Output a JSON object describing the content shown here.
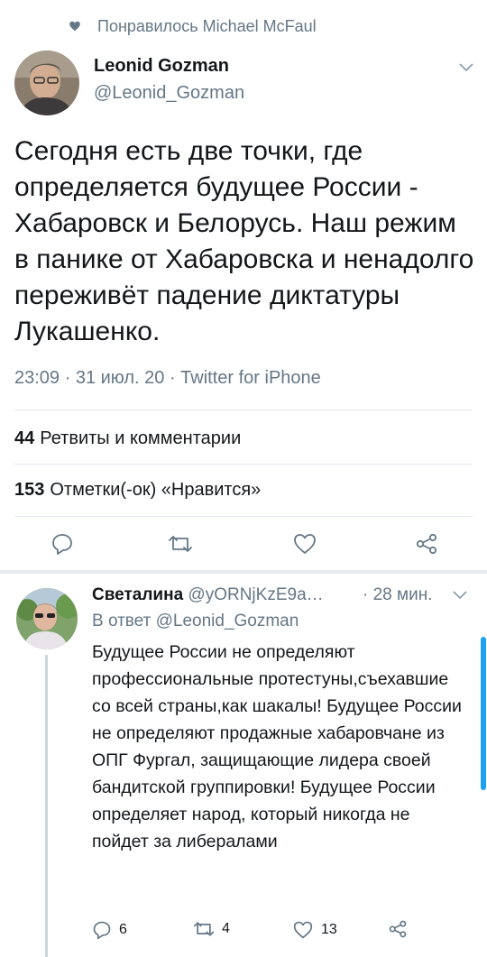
{
  "liked_by": "Понравилось Michael McFaul",
  "tweet": {
    "author_name": "Leonid Gozman",
    "author_handle": "@Leonid_Gozman",
    "text": "Сегодня есть две точки, где определяется будущее России - Хабаровск и Белорусь. Наш режим в панике от Хабаровска и ненадолго переживёт падение диктатуры Лукашенко.",
    "meta": "23:09 · 31 июл. 20 · Twitter for iPhone",
    "retweets_count": "44",
    "retweets_label": "Ретвиты и комментарии",
    "likes_count": "153",
    "likes_label": "Отметки(-ок) «Нравится»"
  },
  "reply": {
    "author_name": "Светалина",
    "author_handle": "@yORNjKzE9a…",
    "time": "· 28 мин.",
    "reply_to": "В ответ @Leonid_Gozman",
    "text": "Будущее России не определяют профессиональные протестуны,съехавшие со всей страны,как шакалы! Будущее России не определяют продажные хабаровчане из ОПГ Фургал, защищающие лидера своей бандитской группировки! Будущее России определяет народ, который никогда не пойдет за либералами",
    "reply_count": "6",
    "retweet_count": "4",
    "like_count": "13"
  },
  "colors": {
    "text": "#14171a",
    "secondary": "#657786",
    "accent": "#1da1f2",
    "divider": "#e1e8ed"
  }
}
